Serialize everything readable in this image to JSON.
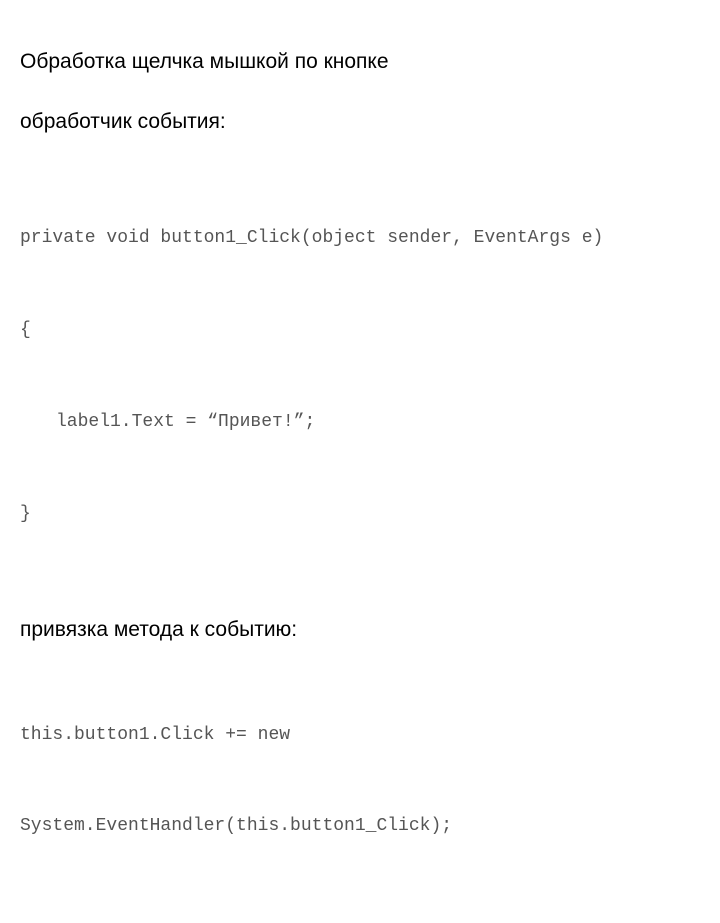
{
  "heading": "Обработка щелчка мышкой по кнопке",
  "sub1": "обработчик события:",
  "code1": {
    "l1": "private void button1_Click(object sender, EventArgs e)",
    "l2": "{",
    "l3": "label1.Text = “Привет!”;",
    "l4": "}"
  },
  "sub2": "привязка метода к событию:",
  "code2": {
    "l1": "this.button1.Click += new",
    "l2": "System.EventHandler(this.button1_Click);"
  }
}
